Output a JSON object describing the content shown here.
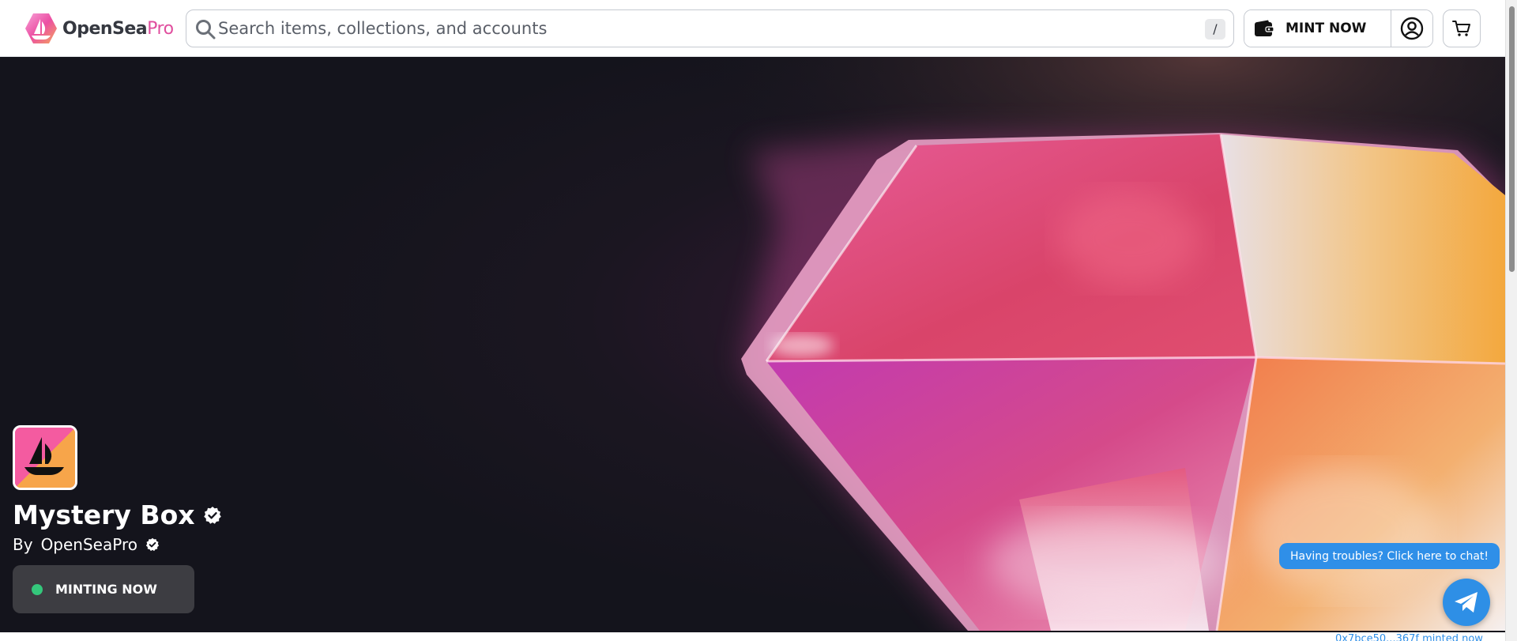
{
  "brand": {
    "name": "OpenSea",
    "suffix": "Pro",
    "icon": "opensea-pro-hex-logo-icon"
  },
  "search": {
    "placeholder": "Search items, collections, and accounts",
    "value": "",
    "shortcut": "/",
    "icon": "search-icon"
  },
  "header_actions": {
    "mint_label": "MINT NOW",
    "mint_icon": "wallet-icon",
    "account_icon": "account-circle-icon",
    "cart_icon": "cart-icon"
  },
  "collection": {
    "name": "Mystery Box",
    "by_label": "By",
    "creator": "OpenSeaPro",
    "verified_icon": "verified-badge-icon",
    "avatar_icon": "opensea-ship-icon",
    "status": "MINTING NOW",
    "status_color": "#34c77b"
  },
  "support": {
    "chat_label": "Having troubles? Click here to chat!",
    "chat_icon": "telegram-icon"
  },
  "ticker": {
    "text": "0x7bce50...367f minted now"
  },
  "colors": {
    "accent": "#2f8fe8",
    "brand_pink": "#e04e9e",
    "hero_bg": "#14141c"
  }
}
